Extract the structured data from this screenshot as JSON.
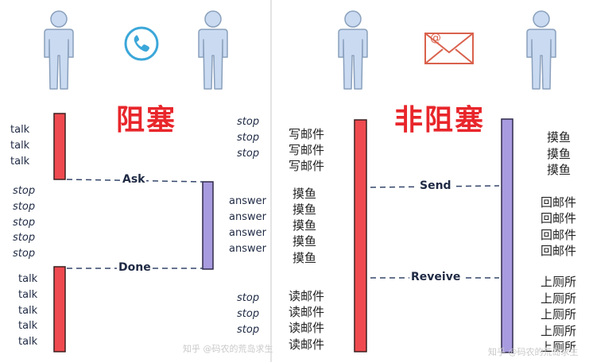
{
  "colors": {
    "person_fill": "#c9daf1",
    "person_stroke": "#8aa0bc",
    "active_red": "#ef4a4f",
    "active_purple": "#a99bdf",
    "phone_accent": "#3ba7d9",
    "mail_accent": "#d9614c",
    "title_red": "#e8262b",
    "dash_line": "#34466a"
  },
  "left": {
    "icon": "phone-icon",
    "title": "阻塞",
    "caller_talk_1": [
      "talk",
      "talk",
      "talk"
    ],
    "caller_stop": [
      "stop",
      "stop",
      "stop",
      "stop",
      "stop"
    ],
    "caller_talk_2": [
      "talk",
      "talk",
      "talk",
      "talk",
      "talk"
    ],
    "callee_stop_1": [
      "stop",
      "stop",
      "stop"
    ],
    "callee_answer": [
      "answer",
      "answer",
      "answer",
      "answer"
    ],
    "callee_stop_2": [
      "stop",
      "stop",
      "stop"
    ],
    "ask_label": "Ask",
    "done_label": "Done",
    "watermark": "知乎 @码农的荒岛求生"
  },
  "right": {
    "icon": "mail-icon",
    "title": "非阻塞",
    "sender_write": [
      "写邮件",
      "写邮件",
      "写邮件"
    ],
    "sender_slack": [
      "摸鱼",
      "摸鱼",
      "摸鱼",
      "摸鱼",
      "摸鱼"
    ],
    "sender_read": [
      "读邮件",
      "读邮件",
      "读邮件",
      "读邮件"
    ],
    "receiver_slack": [
      "摸鱼",
      "摸鱼",
      "摸鱼"
    ],
    "receiver_reply": [
      "回邮件",
      "回邮件",
      "回邮件",
      "回邮件"
    ],
    "receiver_toilet": [
      "上厕所",
      "上厕所",
      "上厕所",
      "上厕所",
      "上厕所"
    ],
    "send_label": "Send",
    "receive_label": "Reveive",
    "watermark": "知乎 @码农的荒岛求生"
  }
}
